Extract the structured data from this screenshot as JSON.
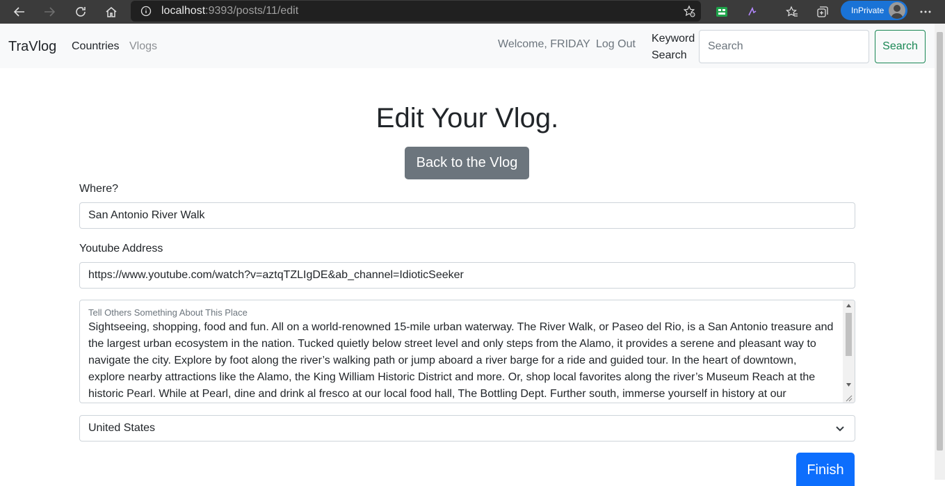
{
  "browser": {
    "url_host": "localhost",
    "url_rest": ":9393/posts/11/edit",
    "inprivate_label": "InPrivate"
  },
  "navbar": {
    "brand": "TraVlog",
    "countries": "Countries",
    "vlogs": "Vlogs",
    "welcome": "Welcome, FRIDAY",
    "logout": "Log Out",
    "keyword_line1": "Keyword",
    "keyword_line2": "Search",
    "search_placeholder": "Search",
    "search_button": "Search"
  },
  "form": {
    "title": "Edit Your Vlog.",
    "back_button": "Back to the Vlog",
    "where_label": "Where?",
    "where_value": "San Antonio River Walk",
    "youtube_label": "Youtube Address",
    "youtube_value": "https://www.youtube.com/watch?v=aztqTZLIgDE&ab_channel=IdioticSeeker",
    "description_label": "Tell Others Something About This Place",
    "description_value": "Sightseeing, shopping, food and fun. All on a world-renowned 15-mile urban waterway. The River Walk, or Paseo del Rio, is a San Antonio treasure and the largest urban ecosystem in the nation. Tucked quietly below street level and only steps from the Alamo, it provides a serene and pleasant way to navigate the city. Explore by foot along the river’s walking path or jump aboard a river barge for a ride and guided tour. In the heart of downtown, explore nearby attractions like the Alamo, the King William Historic District and more. Or, shop local favorites along the river’s Museum Reach at the historic Pearl. While at Pearl, dine and drink al fresco at our local food hall, The Bottling Dept. Further south, immerse yourself in history at our UNESCO",
    "country_value": "United States",
    "finish_button": "Finish"
  }
}
